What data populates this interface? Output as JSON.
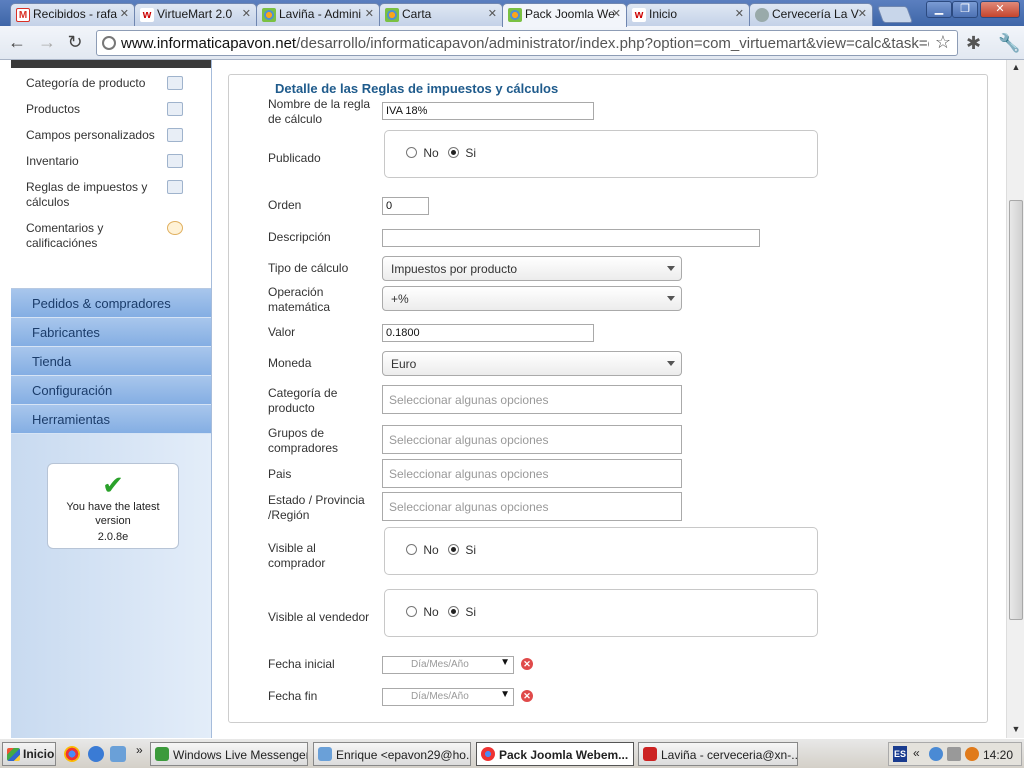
{
  "browser": {
    "tabs": [
      {
        "label": "Recibidos - rafa",
        "icon": "gmail-icon"
      },
      {
        "label": "VirtueMart 2.0",
        "icon": "virtuemart-icon"
      },
      {
        "label": "Laviña - Admini",
        "icon": "joomla-icon"
      },
      {
        "label": "Carta",
        "icon": "joomla-icon"
      },
      {
        "label": "Pack Joomla We",
        "icon": "joomla-icon"
      },
      {
        "label": "Inicio",
        "icon": "virtuemart-icon"
      },
      {
        "label": "Cervecería La V",
        "icon": "globe-icon"
      }
    ],
    "url_host": "www.informaticapavon.net",
    "url_path": "/desarrollo/informaticapavon/administrator/index.php?option=com_virtuemart&view=calc&task=edit&cid["
  },
  "sidebar": {
    "submenu": [
      {
        "label": "Categoría de producto"
      },
      {
        "label": "Productos"
      },
      {
        "label": "Campos personalizados"
      },
      {
        "label": "Inventario"
      },
      {
        "label": "Reglas de impuestos y cálculos"
      },
      {
        "label": "Comentarios y calificaciónes"
      }
    ],
    "sections": [
      {
        "label": "Pedidos & compradores"
      },
      {
        "label": "Fabricantes"
      },
      {
        "label": "Tienda"
      },
      {
        "label": "Configuración"
      },
      {
        "label": "Herramientas"
      }
    ],
    "update_msg": "You have the latest version",
    "version": "2.0.8e"
  },
  "form": {
    "legend": "Detalle de las Reglas de impuestos y cálculos",
    "name_label": "Nombre de la regla de cálculo",
    "name_value": "IVA 18%",
    "published_label": "Publicado",
    "no": "No",
    "yes": "Si",
    "order_label": "Orden",
    "order_value": "0",
    "description_label": "Descripción",
    "description_value": "",
    "calc_type_label": "Tipo de cálculo",
    "calc_type_value": "Impuestos por producto",
    "math_op_label": "Operación matemática",
    "math_op_value": "+%",
    "value_label": "Valor",
    "value_value": "0.1800",
    "currency_label": "Moneda",
    "currency_value": "Euro",
    "category_label": "Categoría de producto",
    "groups_label": "Grupos de compradores",
    "country_label": "Pais",
    "state_label": "Estado / Provincia /Región",
    "multi_placeholder": "Seleccionar algunas opciones",
    "visible_buyer_label": "Visible al comprador",
    "visible_vendor_label": "Visible al vendedor",
    "start_date_label": "Fecha inicial",
    "end_date_label": "Fecha fin",
    "date_placeholder": "Día/Mes/Año"
  },
  "taskbar": {
    "start": "Inicio",
    "tasks": [
      {
        "label": "Windows Live Messenger"
      },
      {
        "label": "Enrique <epavon29@ho..."
      },
      {
        "label": "Pack Joomla Webem..."
      },
      {
        "label": "Laviña - cerveceria@xn-..."
      }
    ],
    "lang": "ES",
    "clock": "14:20"
  }
}
